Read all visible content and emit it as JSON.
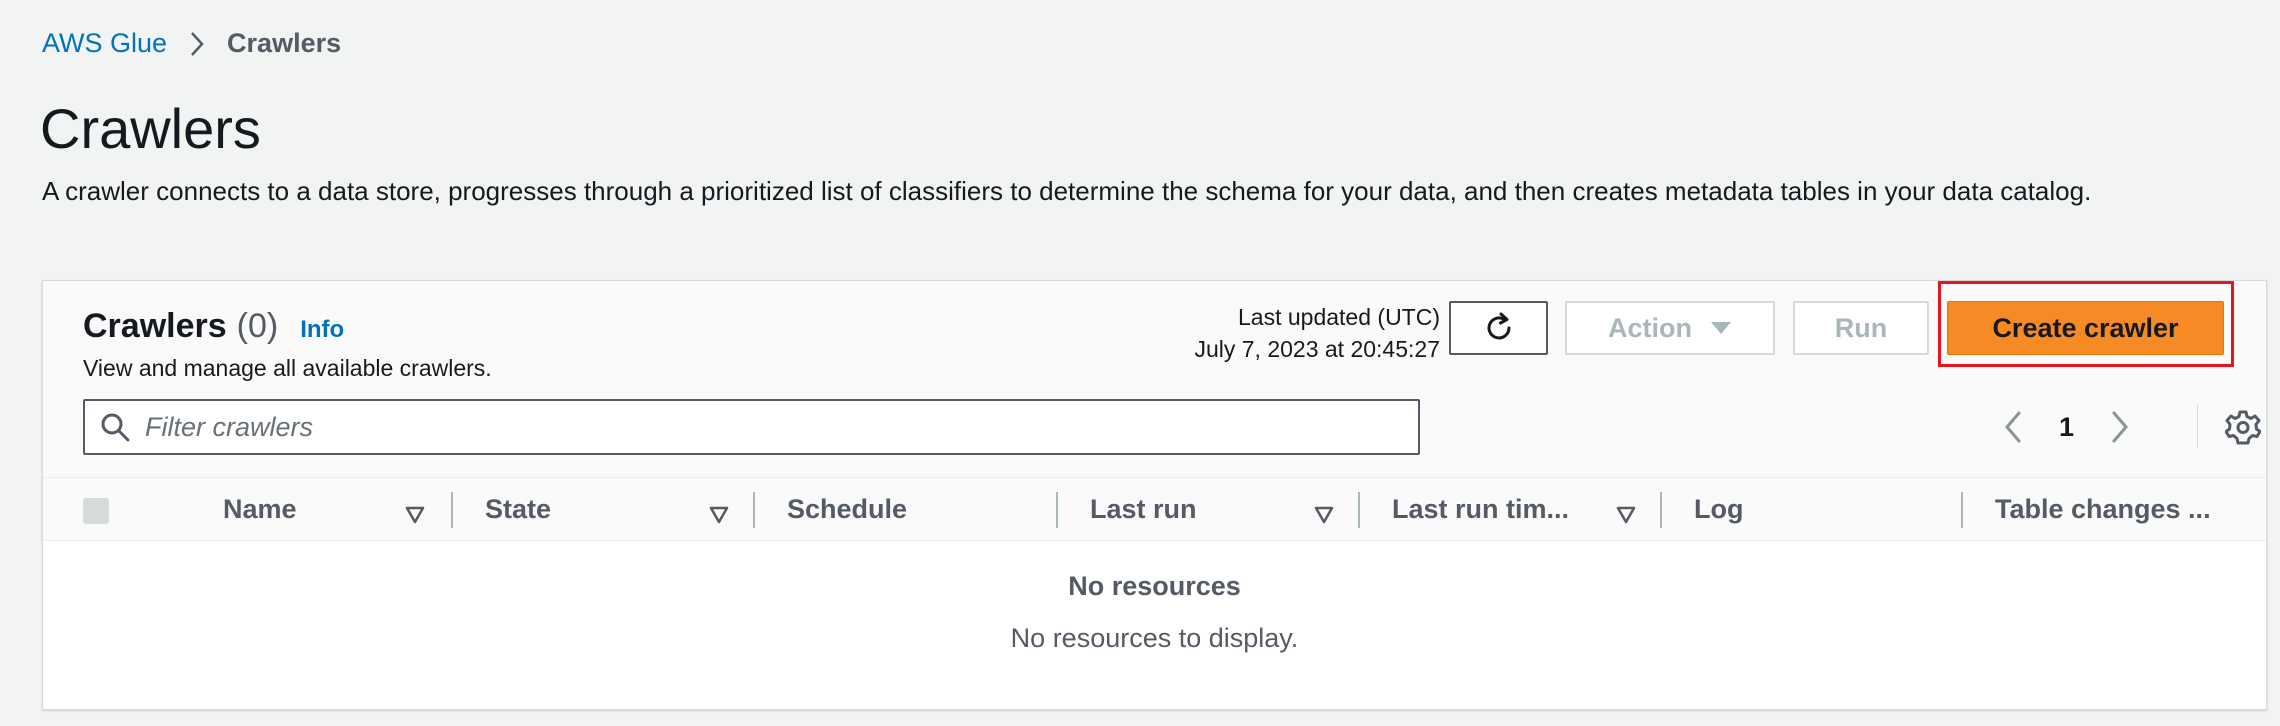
{
  "breadcrumb": {
    "parent": "AWS Glue",
    "current": "Crawlers"
  },
  "page": {
    "title": "Crawlers",
    "description": "A crawler connects to a data store, progresses through a prioritized list of classifiers to determine the schema for your data, and then creates metadata tables in your data catalog."
  },
  "panel": {
    "title": "Crawlers",
    "count": "(0)",
    "info_link": "Info",
    "subtitle": "View and manage all available crawlers.",
    "last_updated_label": "Last updated (UTC)",
    "last_updated_value": "July 7, 2023 at 20:45:27"
  },
  "toolbar": {
    "action_label": "Action",
    "run_label": "Run",
    "create_label": "Create crawler"
  },
  "filter": {
    "placeholder": "Filter crawlers"
  },
  "pagination": {
    "current_page": "1"
  },
  "table": {
    "columns": [
      {
        "label": "Name"
      },
      {
        "label": "State"
      },
      {
        "label": "Schedule"
      },
      {
        "label": "Last run"
      },
      {
        "label": "Last run tim..."
      },
      {
        "label": "Log"
      },
      {
        "label": "Table changes ..."
      }
    ],
    "empty_title": "No resources",
    "empty_message": "No resources to display."
  },
  "colors": {
    "link": "#0073bb",
    "primary_button": "#f68a24",
    "highlight_box": "#e5141f",
    "background": "#f2f3f3"
  },
  "icons": [
    "chevron-right-icon",
    "refresh-icon",
    "caret-down-icon",
    "search-icon",
    "chevron-left-icon",
    "gear-icon",
    "sort-icon"
  ]
}
